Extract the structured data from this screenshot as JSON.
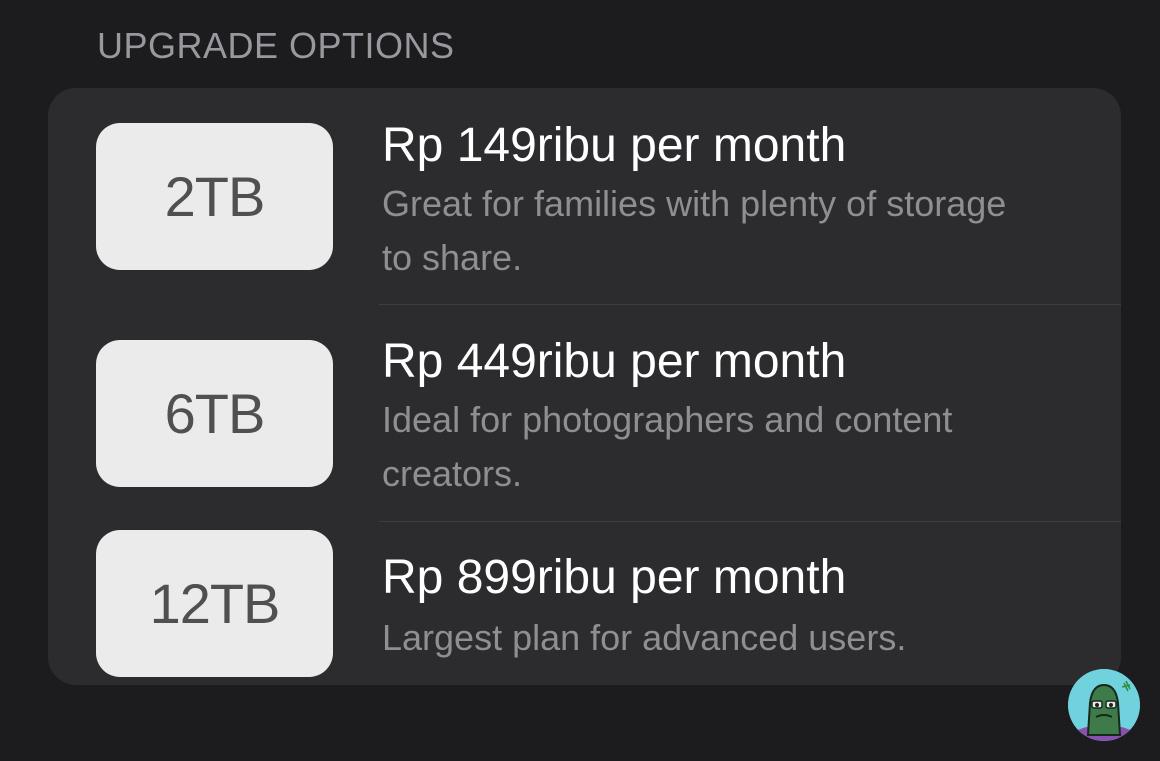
{
  "section": {
    "header": "UPGRADE OPTIONS"
  },
  "plans": [
    {
      "size": "2TB",
      "price": "Rp 149ribu per month",
      "description": "Great for families with plenty of storage to share."
    },
    {
      "size": "6TB",
      "price": "Rp 449ribu per month",
      "description": "Ideal for photographers and content creators."
    },
    {
      "size": "12TB",
      "price": "Rp 899ribu per month",
      "description": "Largest plan for advanced users."
    }
  ],
  "colors": {
    "background": "#1c1c1e",
    "card": "#2c2c2e",
    "badge": "#ebebeb",
    "primary_text": "#ffffff",
    "secondary_text": "#8e8e93"
  },
  "icons": {
    "avatar": "user-avatar-icon"
  }
}
